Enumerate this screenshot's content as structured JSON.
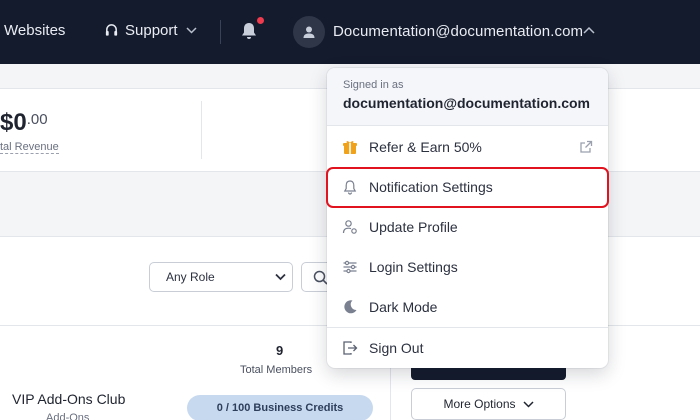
{
  "topbar": {
    "websites": "Websites",
    "support": "Support",
    "account_email": "Documentation@documentation.com",
    "notification_dot_color": "#ef3b4d"
  },
  "stats": {
    "revenue_main": "$0",
    "revenue_cents": ".00",
    "revenue_label": "tal Revenue"
  },
  "filters": {
    "role_select": "Any Role"
  },
  "group": {
    "members_count": "9",
    "members_label": "Total Members",
    "name": "VIP Add-Ons Club",
    "subtitle": "Add-Ons",
    "credits": "0 / 100 Business Credits",
    "more_options": "More Options"
  },
  "account_menu": {
    "signed_in_label": "Signed in as",
    "email": "documentation@documentation.com",
    "items": [
      {
        "label": "Refer & Earn 50%",
        "icon": "gift-icon",
        "color": "#f0a21a"
      },
      {
        "label": "Notification Settings",
        "icon": "bell-icon"
      },
      {
        "label": "Update Profile",
        "icon": "user-gear-icon"
      },
      {
        "label": "Login Settings",
        "icon": "sliders-icon"
      },
      {
        "label": "Dark Mode",
        "icon": "moon-icon"
      }
    ],
    "sign_out": "Sign Out",
    "highlight_color": "#e0131f"
  }
}
